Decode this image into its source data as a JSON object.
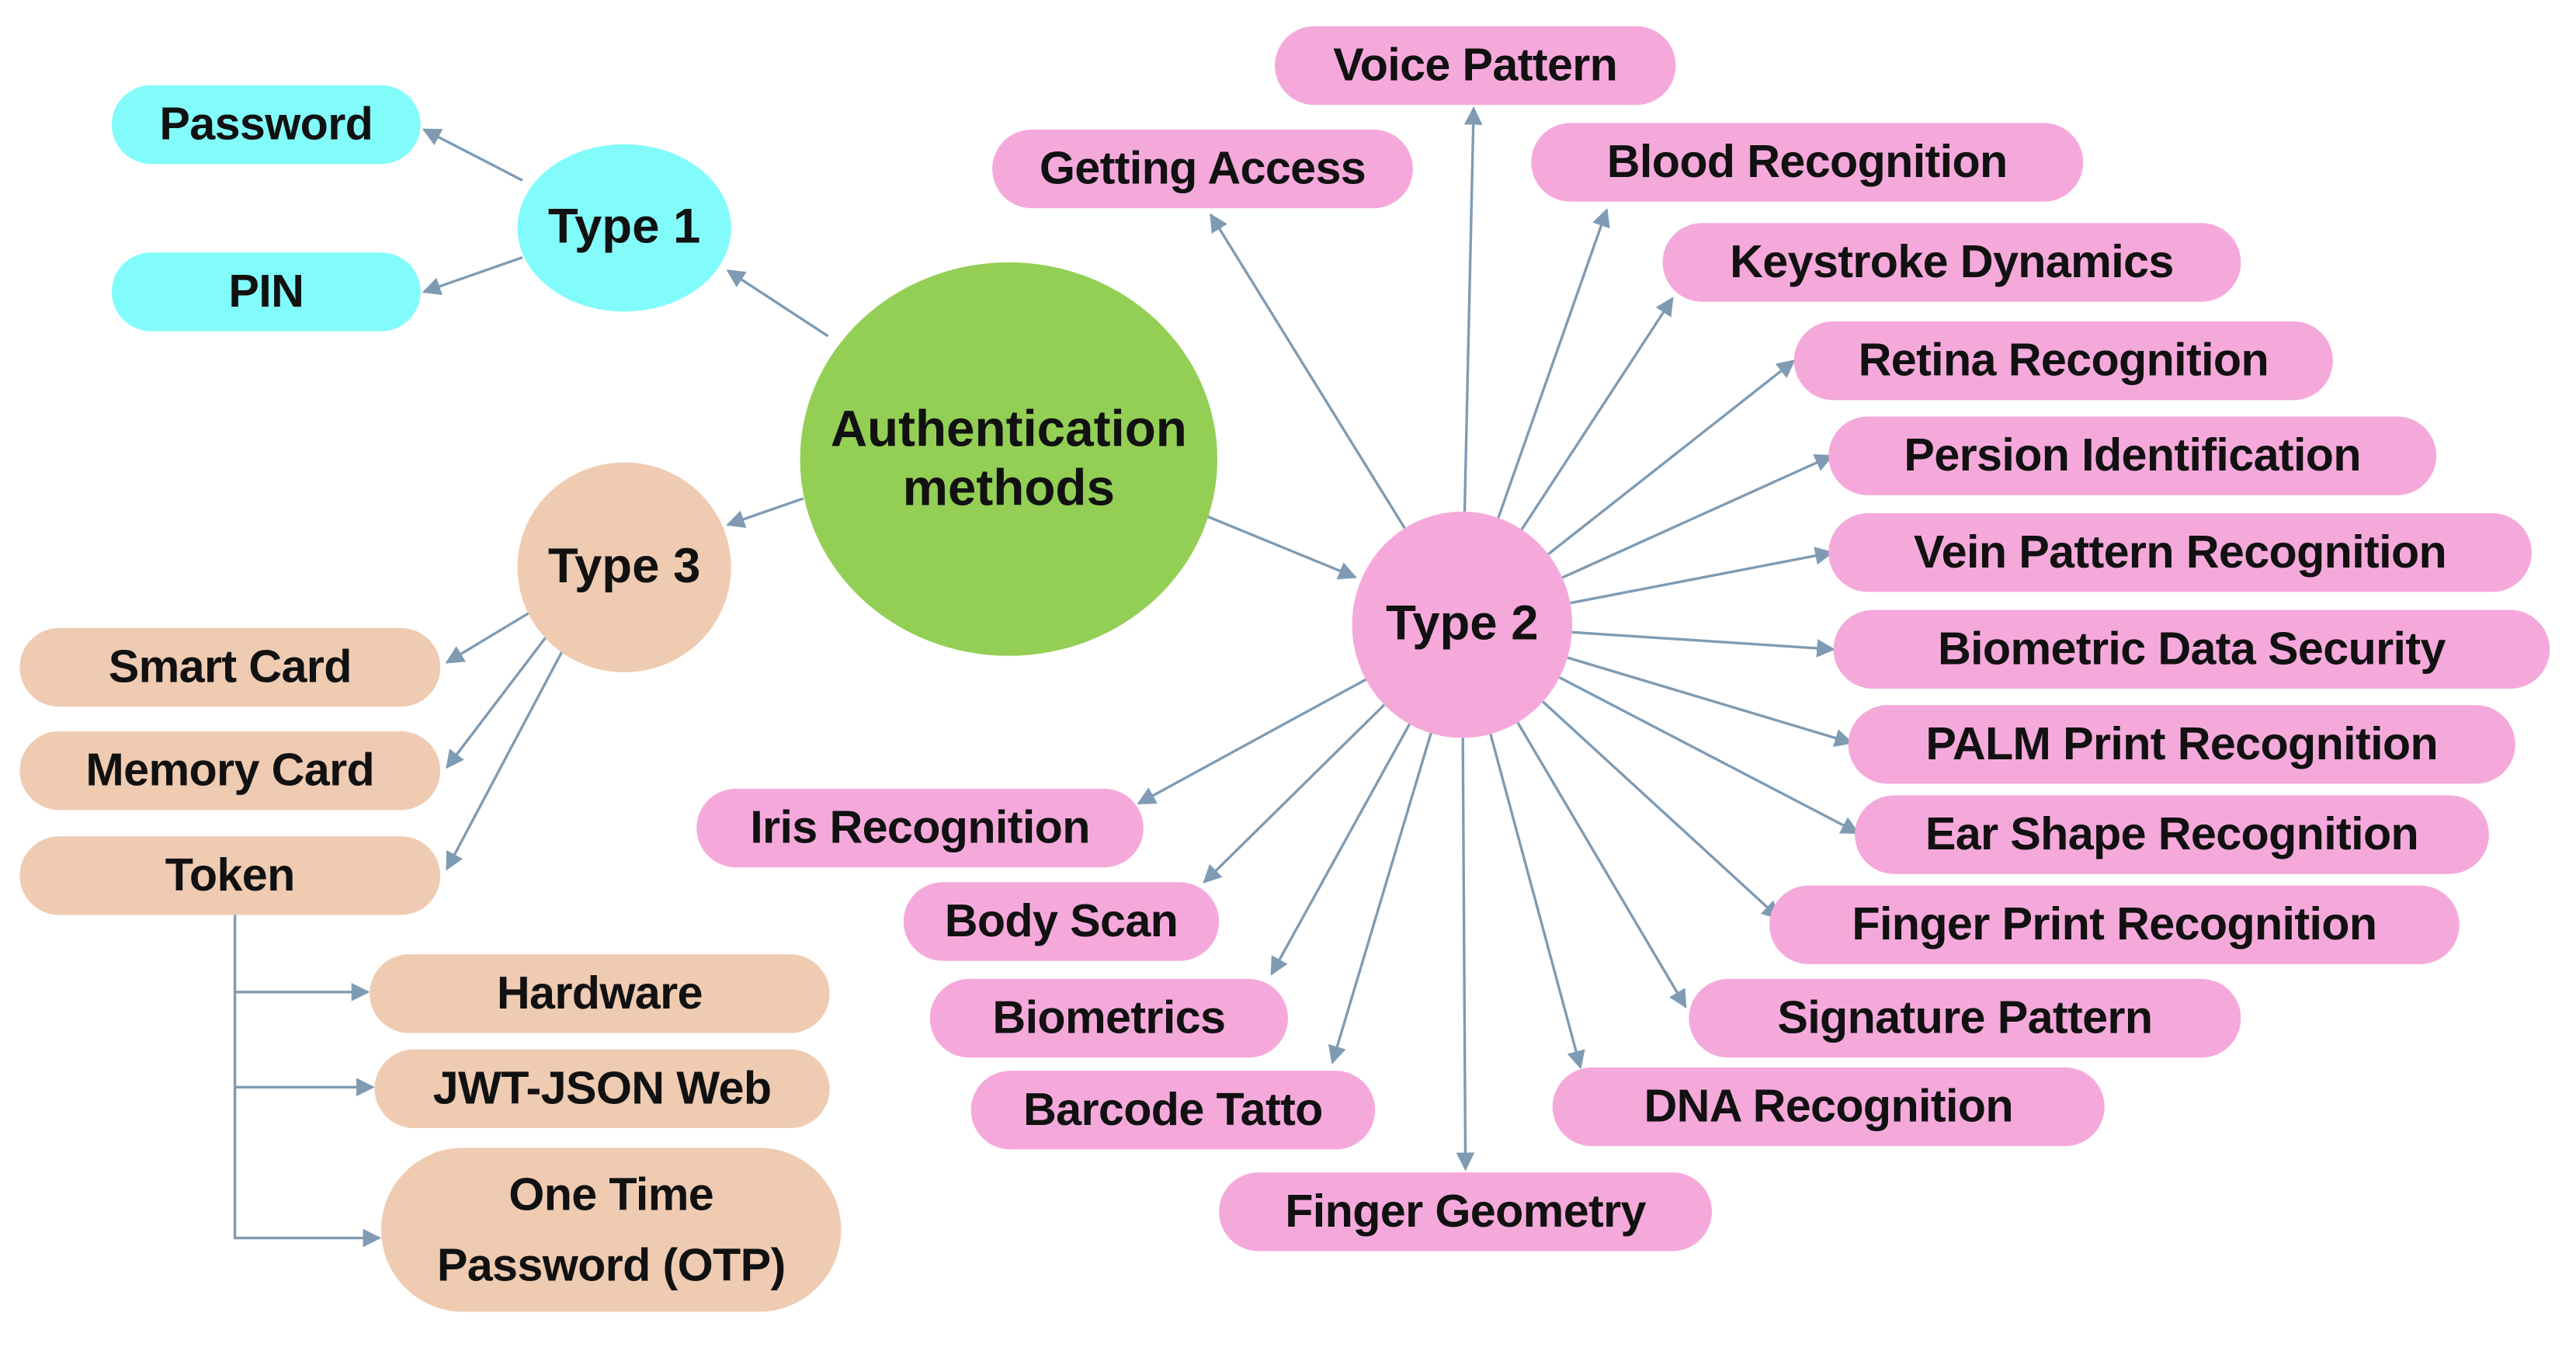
{
  "diagram": {
    "title": "Authentication methods",
    "colors": {
      "root": "#93cf55",
      "type1": "#82fbfb",
      "type2": "#f5a9db",
      "type3": "#efcbb2",
      "edge": "#7f9bb3",
      "text": "#111111"
    },
    "root": {
      "label": "Authentication methods"
    },
    "type1": {
      "label": "Type 1",
      "children": [
        "Password",
        "PIN"
      ]
    },
    "type3": {
      "label": "Type 3",
      "children": [
        "Smart Card",
        "Memory Card",
        "Token"
      ],
      "token_children": [
        "Hardware",
        "JWT-JSON Web",
        "One Time Password (OTP)"
      ]
    },
    "type2": {
      "label": "Type 2",
      "children": [
        "Voice Pattern",
        "Getting Access",
        "Blood Recognition",
        "Keystroke Dynamics",
        "Retina Recognition",
        "Persion Identification",
        "Vein Pattern Recognition",
        "Biometric Data Security",
        "PALM Print Recognition",
        "Ear Shape Recognition",
        "Finger Print Recognition",
        "Signature Pattern",
        "DNA Recognition",
        "Finger Geometry",
        "Barcode Tatto",
        "Biometrics",
        "Body Scan",
        "Iris Recognition"
      ]
    }
  }
}
